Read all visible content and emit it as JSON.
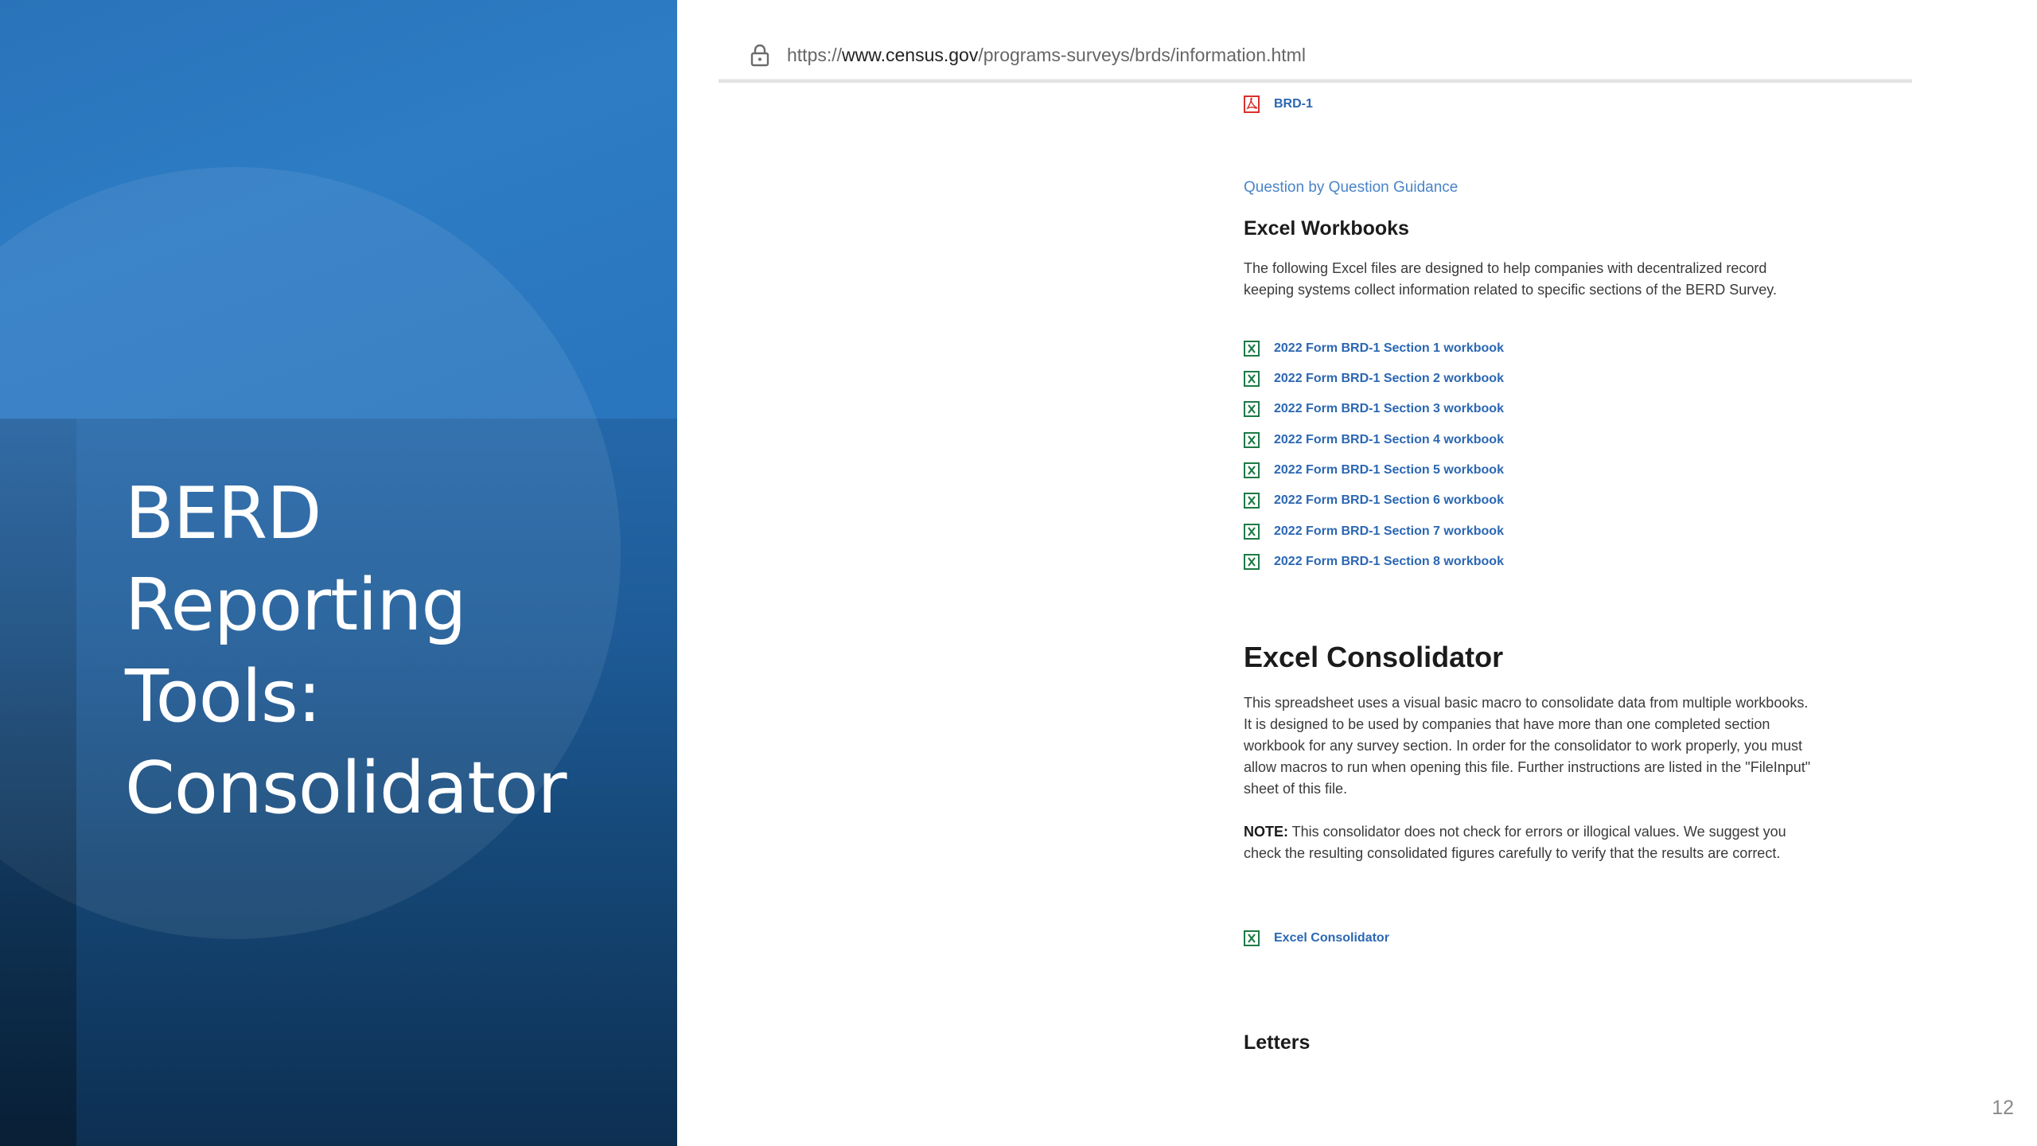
{
  "slide": {
    "title_lines": [
      "BERD",
      "Reporting",
      "Tools:",
      "Consolidator"
    ],
    "page_number": "12"
  },
  "browser": {
    "url_prefix": "https://",
    "url_domain": "www.census.gov",
    "url_path": "/programs-surveys/brds/information.html",
    "lock_icon": "lock-icon"
  },
  "page": {
    "form_link": {
      "label": "BRD-1",
      "icon": "pdf-icon"
    },
    "guidance_link": "Question by Question Guidance",
    "workbooks": {
      "heading": "Excel Workbooks",
      "description": "The following Excel files are designed to help companies with decentralized record keeping systems collect information related to specific sections of the BERD Survey.",
      "icon": "excel-icon",
      "links": [
        "2022 Form BRD-1 Section 1 workbook",
        "2022 Form BRD-1 Section 2 workbook",
        "2022 Form BRD-1 Section 3 workbook",
        "2022 Form BRD-1 Section 4 workbook",
        "2022 Form BRD-1 Section 5 workbook",
        "2022 Form BRD-1 Section 6 workbook",
        "2022 Form BRD-1 Section 7 workbook",
        "2022 Form BRD-1 Section 8 workbook"
      ]
    },
    "consolidator": {
      "heading": "Excel Consolidator",
      "description": "This spreadsheet uses a visual basic macro to consolidate data from multiple workbooks. It is designed to be used by companies that have more than one completed section workbook for any survey section. In order for the consolidator to work properly, you must allow macros to run when opening this file. Further instructions are listed in the \"FileInput\" sheet of this file.",
      "note_label": "NOTE:",
      "note_text": " This consolidator does not check for errors or illogical values. We suggest you check the resulting consolidated figures carefully to verify that the results are correct.",
      "link": "Excel Consolidator",
      "icon": "excel-icon"
    },
    "letters_heading": "Letters"
  },
  "colors": {
    "panel_blue": "#2a73ba",
    "link_blue": "#2b67b3",
    "excel_green": "#1d7a45",
    "pdf_red": "#d9302c"
  }
}
